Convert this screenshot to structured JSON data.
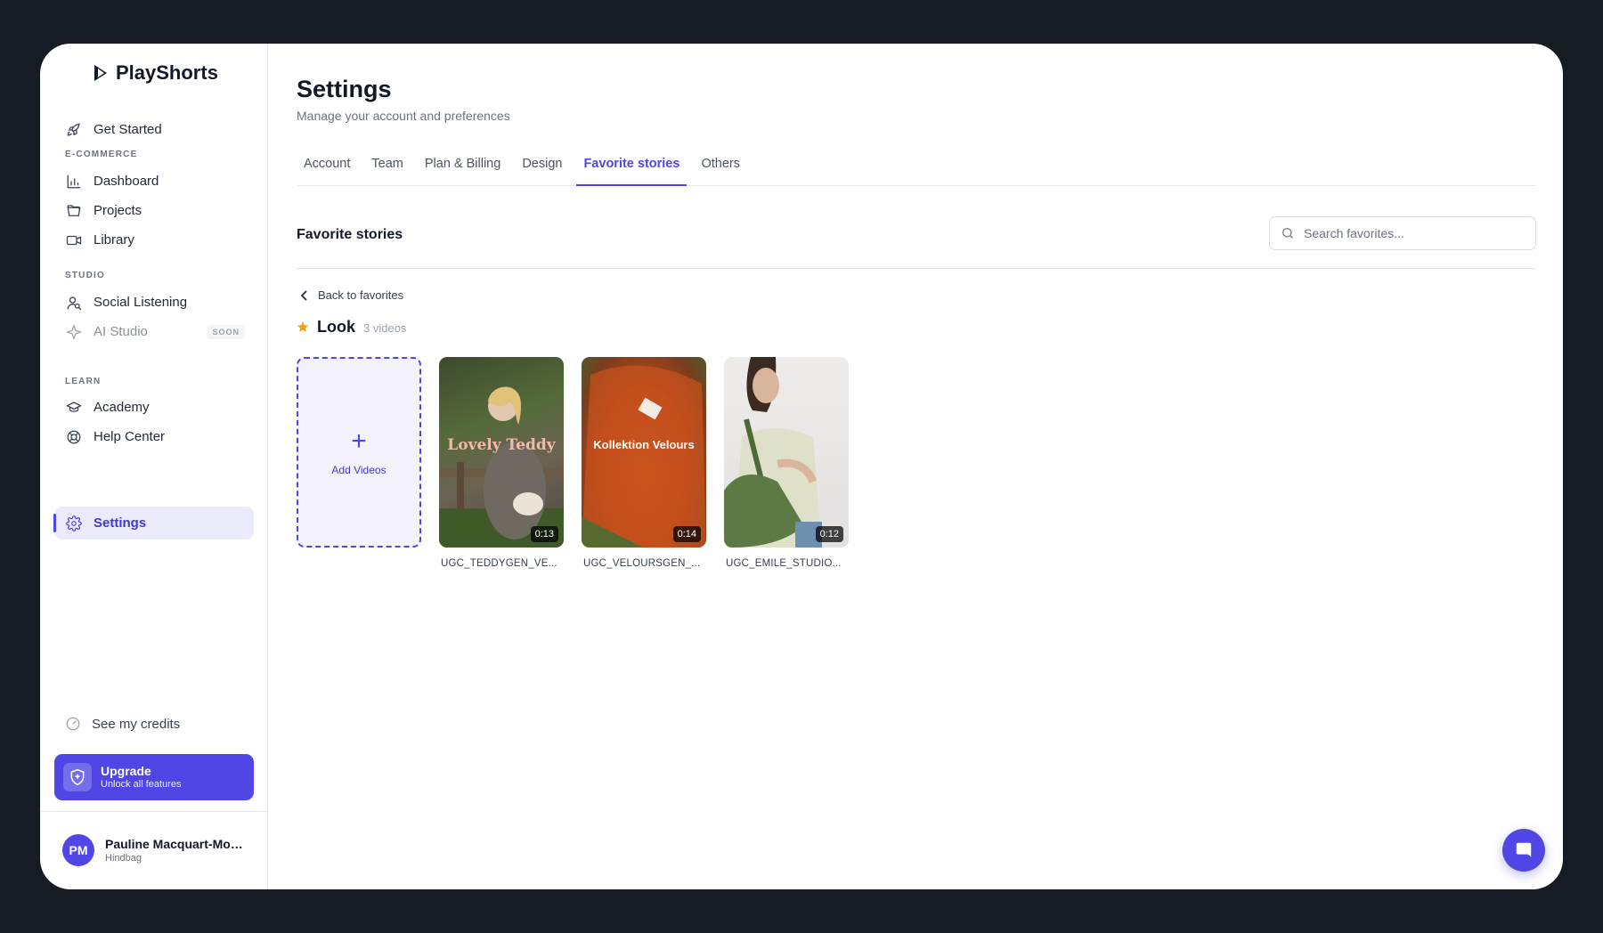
{
  "app": {
    "name": "PlayShorts"
  },
  "sidebar": {
    "get_started": "Get Started",
    "sections": {
      "ecommerce": "E-COMMERCE",
      "studio": "STUDIO",
      "learn": "LEARN"
    },
    "items": {
      "dashboard": "Dashboard",
      "projects": "Projects",
      "library": "Library",
      "social_listening": "Social Listening",
      "ai_studio": "AI Studio",
      "ai_studio_badge": "SOON",
      "academy": "Academy",
      "help_center": "Help Center",
      "settings": "Settings"
    },
    "credits": "See my credits",
    "upgrade": {
      "title": "Upgrade",
      "subtitle": "Unlock all features"
    },
    "user": {
      "initials": "PM",
      "name": "Pauline Macquart-Mou...",
      "org": "Hindbag"
    }
  },
  "page": {
    "title": "Settings",
    "subtitle": "Manage your account and preferences",
    "tabs": [
      "Account",
      "Team",
      "Plan & Billing",
      "Design",
      "Favorite stories",
      "Others"
    ],
    "active_tab": "Favorite stories"
  },
  "favorites": {
    "section_title": "Favorite stories",
    "search_placeholder": "Search favorites...",
    "back_label": "Back to favorites",
    "folder_name": "Look",
    "folder_count": "3 videos",
    "add_label": "Add Videos",
    "videos": [
      {
        "name": "UGC_TEDDYGEN_VE...",
        "duration": "0:13",
        "overlay": "Lovely Teddy"
      },
      {
        "name": "UGC_VELOURSGEN_...",
        "duration": "0:14",
        "overlay": "Kollektion Velours"
      },
      {
        "name": "UGC_EMILE_STUDIO...",
        "duration": "0:12",
        "overlay": ""
      }
    ]
  },
  "colors": {
    "accent": "#4f46e5",
    "star": "#f59e0b"
  }
}
